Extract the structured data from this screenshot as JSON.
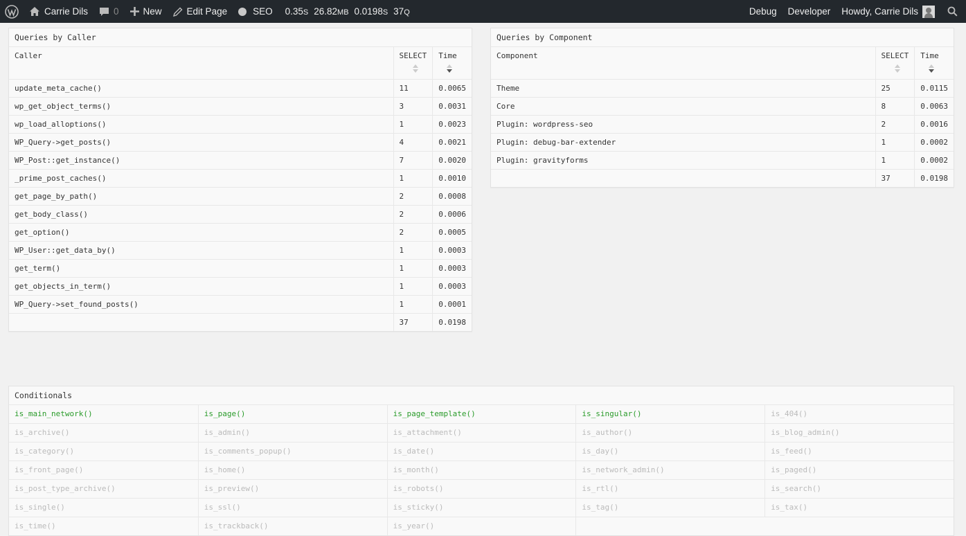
{
  "adminbar": {
    "site_name": "Carrie Dils",
    "comments_count": "0",
    "new_label": "New",
    "edit_label": "Edit Page",
    "seo_label": "SEO",
    "stats": {
      "time_value": "0.35",
      "time_unit": "S",
      "memory_value": "26.82",
      "memory_unit": "MB",
      "query_time_value": "0.0198",
      "query_time_unit": "S",
      "query_count_value": "37",
      "query_count_unit": "Q"
    },
    "debug_label": "Debug",
    "developer_label": "Developer",
    "howdy_label": "Howdy, Carrie Dils"
  },
  "callers": {
    "title": "Queries by Caller",
    "headers": [
      "Caller",
      "SELECT",
      "Time"
    ],
    "rows": [
      [
        "update_meta_cache()",
        "11",
        "0.0065"
      ],
      [
        "wp_get_object_terms()",
        "3",
        "0.0031"
      ],
      [
        "wp_load_alloptions()",
        "1",
        "0.0023"
      ],
      [
        "WP_Query->get_posts()",
        "4",
        "0.0021"
      ],
      [
        "WP_Post::get_instance()",
        "7",
        "0.0020"
      ],
      [
        "_prime_post_caches()",
        "1",
        "0.0010"
      ],
      [
        "get_page_by_path()",
        "2",
        "0.0008"
      ],
      [
        "get_body_class()",
        "2",
        "0.0006"
      ],
      [
        "get_option()",
        "2",
        "0.0005"
      ],
      [
        "WP_User::get_data_by()",
        "1",
        "0.0003"
      ],
      [
        "get_term()",
        "1",
        "0.0003"
      ],
      [
        "get_objects_in_term()",
        "1",
        "0.0003"
      ],
      [
        "WP_Query->set_found_posts()",
        "1",
        "0.0001"
      ]
    ],
    "total": [
      "",
      "37",
      "0.0198"
    ]
  },
  "components": {
    "title": "Queries by Component",
    "headers": [
      "Component",
      "SELECT",
      "Time"
    ],
    "rows": [
      [
        "Theme",
        "25",
        "0.0115"
      ],
      [
        "Core",
        "8",
        "0.0063"
      ],
      [
        "Plugin: wordpress-seo",
        "2",
        "0.0016"
      ],
      [
        "Plugin: debug-bar-extender",
        "1",
        "0.0002"
      ],
      [
        "Plugin: gravityforms",
        "1",
        "0.0002"
      ]
    ],
    "total": [
      "",
      "37",
      "0.0198"
    ]
  },
  "conditionals": {
    "title": "Conditionals",
    "true_color": "#2a9b2a",
    "false_color": "#bbbbbb",
    "items": [
      {
        "name": "is_main_network()",
        "state": true
      },
      {
        "name": "is_page()",
        "state": true
      },
      {
        "name": "is_page_template()",
        "state": true
      },
      {
        "name": "is_singular()",
        "state": true
      },
      {
        "name": "is_404()",
        "state": false
      },
      {
        "name": "is_archive()",
        "state": false
      },
      {
        "name": "is_admin()",
        "state": false
      },
      {
        "name": "is_attachment()",
        "state": false
      },
      {
        "name": "is_author()",
        "state": false
      },
      {
        "name": "is_blog_admin()",
        "state": false
      },
      {
        "name": "is_category()",
        "state": false
      },
      {
        "name": "is_comments_popup()",
        "state": false
      },
      {
        "name": "is_date()",
        "state": false
      },
      {
        "name": "is_day()",
        "state": false
      },
      {
        "name": "is_feed()",
        "state": false
      },
      {
        "name": "is_front_page()",
        "state": false
      },
      {
        "name": "is_home()",
        "state": false
      },
      {
        "name": "is_month()",
        "state": false
      },
      {
        "name": "is_network_admin()",
        "state": false
      },
      {
        "name": "is_paged()",
        "state": false
      },
      {
        "name": "is_post_type_archive()",
        "state": false
      },
      {
        "name": "is_preview()",
        "state": false
      },
      {
        "name": "is_robots()",
        "state": false
      },
      {
        "name": "is_rtl()",
        "state": false
      },
      {
        "name": "is_search()",
        "state": false
      },
      {
        "name": "is_single()",
        "state": false
      },
      {
        "name": "is_ssl()",
        "state": false
      },
      {
        "name": "is_sticky()",
        "state": false
      },
      {
        "name": "is_tag()",
        "state": false
      },
      {
        "name": "is_tax()",
        "state": false
      },
      {
        "name": "is_time()",
        "state": false
      },
      {
        "name": "is_trackback()",
        "state": false
      },
      {
        "name": "is_year()",
        "state": false
      }
    ]
  }
}
